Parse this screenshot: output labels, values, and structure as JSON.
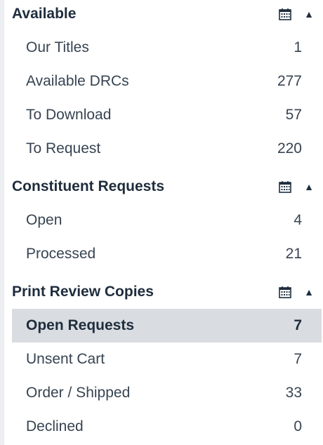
{
  "sections": [
    {
      "title": "Available",
      "calendar_icon": "calendar-icon",
      "caret_icon": "caret-up-icon",
      "items": [
        {
          "label": "Our Titles",
          "count": "1"
        },
        {
          "label": "Available DRCs",
          "count": "277"
        },
        {
          "label": "To Download",
          "count": "57"
        },
        {
          "label": "To Request",
          "count": "220"
        }
      ]
    },
    {
      "title": "Constituent Requests",
      "calendar_icon": "calendar-icon",
      "caret_icon": "caret-up-icon",
      "items": [
        {
          "label": "Open",
          "count": "4"
        },
        {
          "label": "Processed",
          "count": "21"
        }
      ]
    },
    {
      "title": "Print Review Copies",
      "calendar_icon": "calendar-icon",
      "caret_icon": "caret-up-icon",
      "items": [
        {
          "label": "Open Requests",
          "count": "7",
          "active": true
        },
        {
          "label": "Unsent Cart",
          "count": "7"
        },
        {
          "label": "Order / Shipped",
          "count": "33"
        },
        {
          "label": "Declined",
          "count": "0"
        }
      ]
    }
  ],
  "colors": {
    "active_bg": "#d9dde1",
    "text": "#374452",
    "header_text": "#1f2d3d",
    "edge": "#eceef1"
  }
}
